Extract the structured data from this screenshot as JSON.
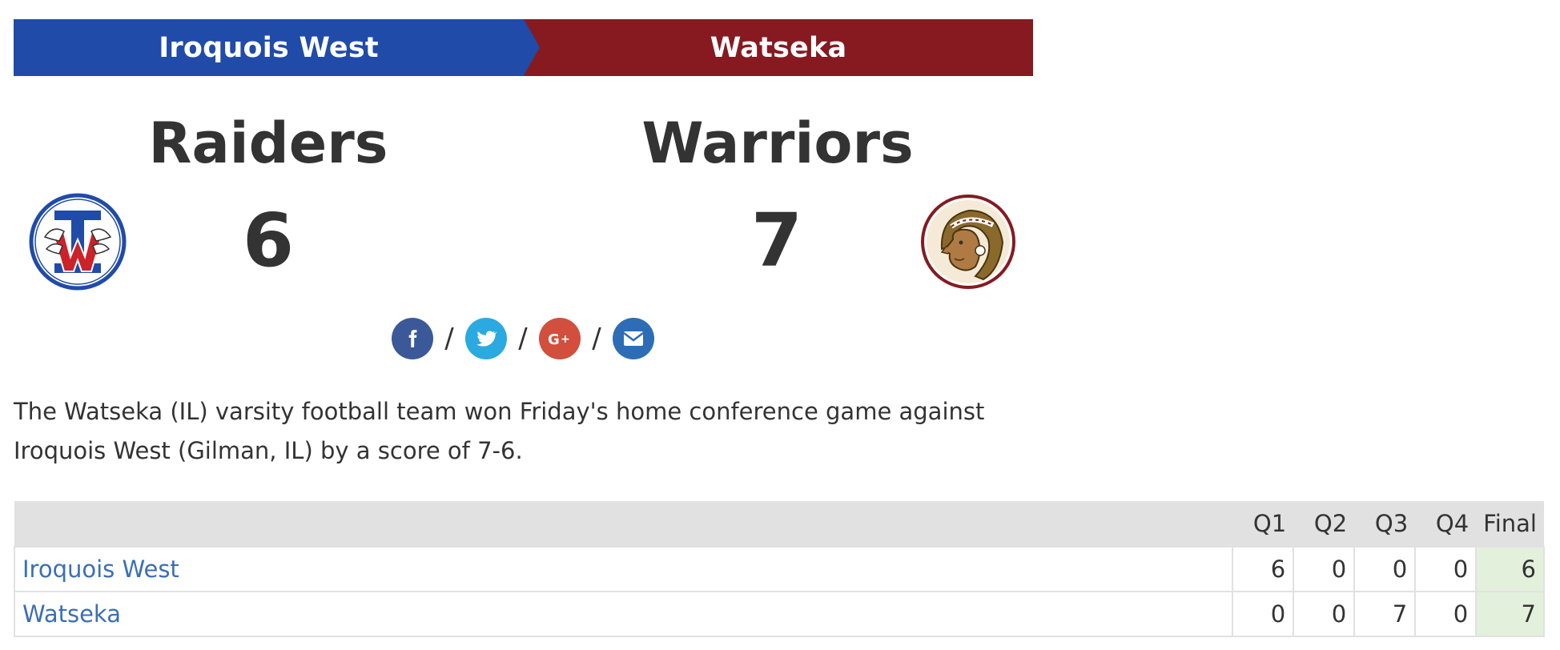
{
  "banner": {
    "away_name": "Iroquois West",
    "home_name": "Watseka",
    "away_color": "#204ba9",
    "home_color": "#861a20"
  },
  "teams": {
    "away": {
      "mascot": "Raiders",
      "score": "6",
      "logo_icon": "iroquois-west-logo-icon"
    },
    "home": {
      "mascot": "Warriors",
      "score": "7",
      "logo_icon": "watseka-warriors-logo-icon"
    }
  },
  "share": {
    "separator": "/",
    "buttons": [
      {
        "icon": "facebook-icon",
        "color": "#3b5998"
      },
      {
        "icon": "twitter-icon",
        "color": "#2ba9e1"
      },
      {
        "icon": "google-plus-icon",
        "color": "#d14f3c"
      },
      {
        "icon": "email-icon",
        "color": "#2d6db5"
      }
    ]
  },
  "summary": "The Watseka (IL) varsity football team won Friday's home conference game against Iroquois West (Gilman, IL) by a score of 7-6.",
  "linescore": {
    "headers": [
      "Q1",
      "Q2",
      "Q3",
      "Q4",
      "Final"
    ],
    "rows": [
      {
        "team": "Iroquois West",
        "q": [
          "6",
          "0",
          "0",
          "0"
        ],
        "final": "6"
      },
      {
        "team": "Watseka",
        "q": [
          "0",
          "0",
          "7",
          "0"
        ],
        "final": "7"
      }
    ]
  }
}
